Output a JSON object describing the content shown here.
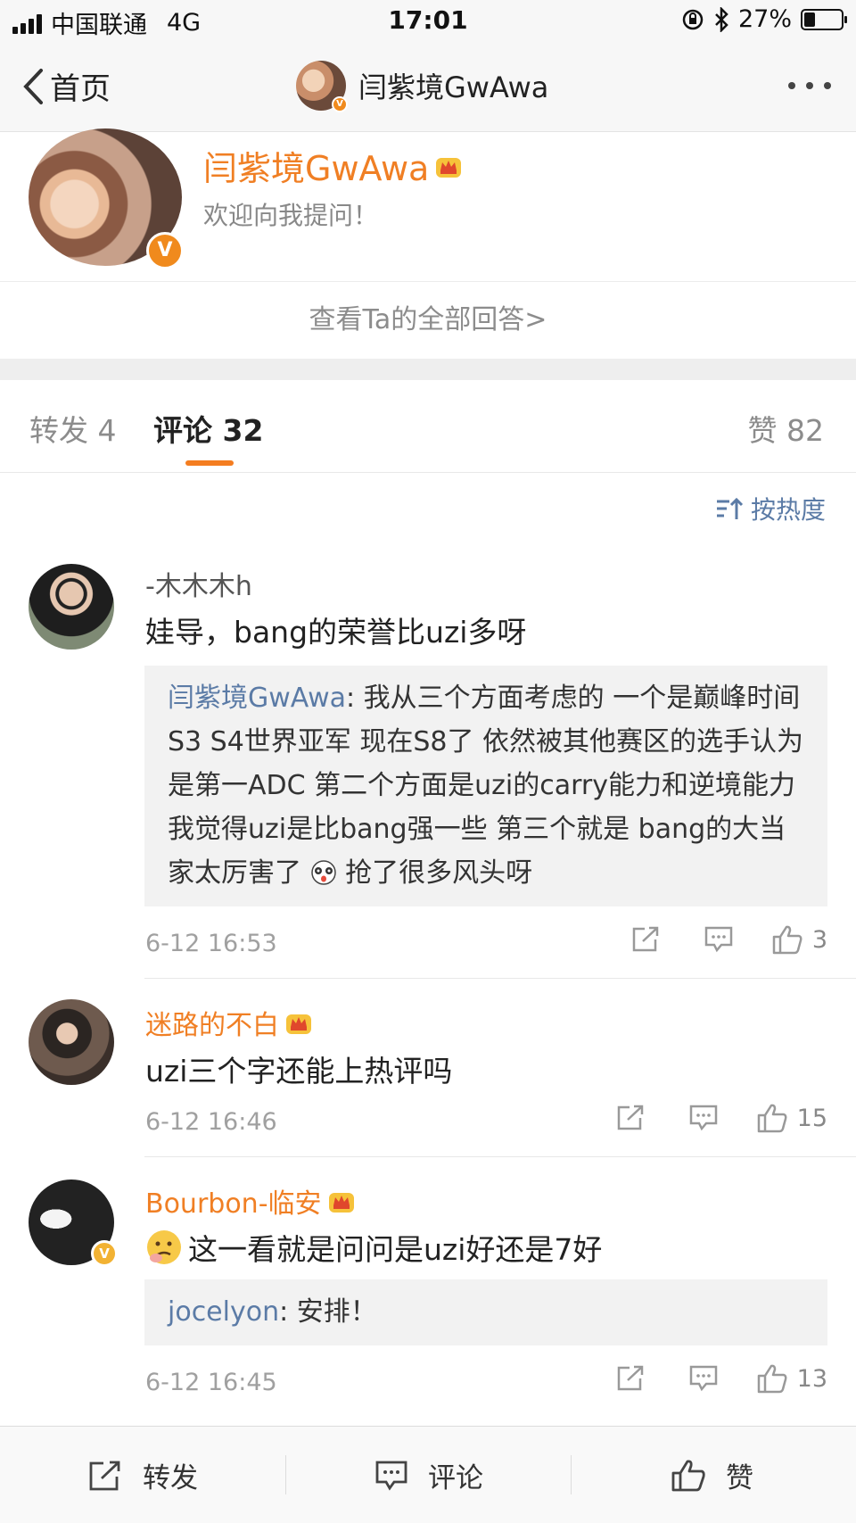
{
  "status_bar": {
    "carrier": "中国联通",
    "network": "4G",
    "time": "17:01",
    "battery": "27%",
    "battery_level": 0.27
  },
  "nav": {
    "back_label": "首页",
    "title": "闫紫境GwAwa"
  },
  "profile": {
    "name": "闫紫境GwAwa",
    "subtitle": "欢迎向我提问！",
    "view_all": "查看Ta的全部回答>"
  },
  "tabs": {
    "repost": "转发 4",
    "comment": "评论 32",
    "like": "赞 82"
  },
  "sort_label": "按热度",
  "comments": [
    {
      "name": "-木木木h",
      "text": "娃导，bang的荣誉比uzi多呀",
      "reply_name": "闫紫境GwAwa",
      "reply_text": ": 我从三个方面考虑的 一个是巅峰时间 S3 S4世界亚军 现在S8了 依然被其他赛区的选手认为是第一ADC 第二个方面是uzi的carry能力和逆境能力 我觉得uzi是比bang强一些 第三个就是 bang的大当家太厉害了",
      "reply_tail": " 抢了很多风头呀",
      "time": "6-12 16:53",
      "likes": "3"
    },
    {
      "name": "迷路的不白",
      "text": "uzi三个字还能上热评吗",
      "time": "6-12 16:46",
      "likes": "15"
    },
    {
      "name": "Bourbon-临安",
      "text": "这一看就是问问是uzi好还是7好",
      "reply_name": "jocelyon",
      "reply_text": ": 安排！",
      "time": "6-12 16:45",
      "likes": "13"
    }
  ],
  "bottom_bar": {
    "repost": "转发",
    "comment": "评论",
    "like": "赞"
  },
  "colors": {
    "accent_orange": "#f07f24",
    "link_blue": "#5b7ba6",
    "verified_orange": "#f08a1d"
  }
}
